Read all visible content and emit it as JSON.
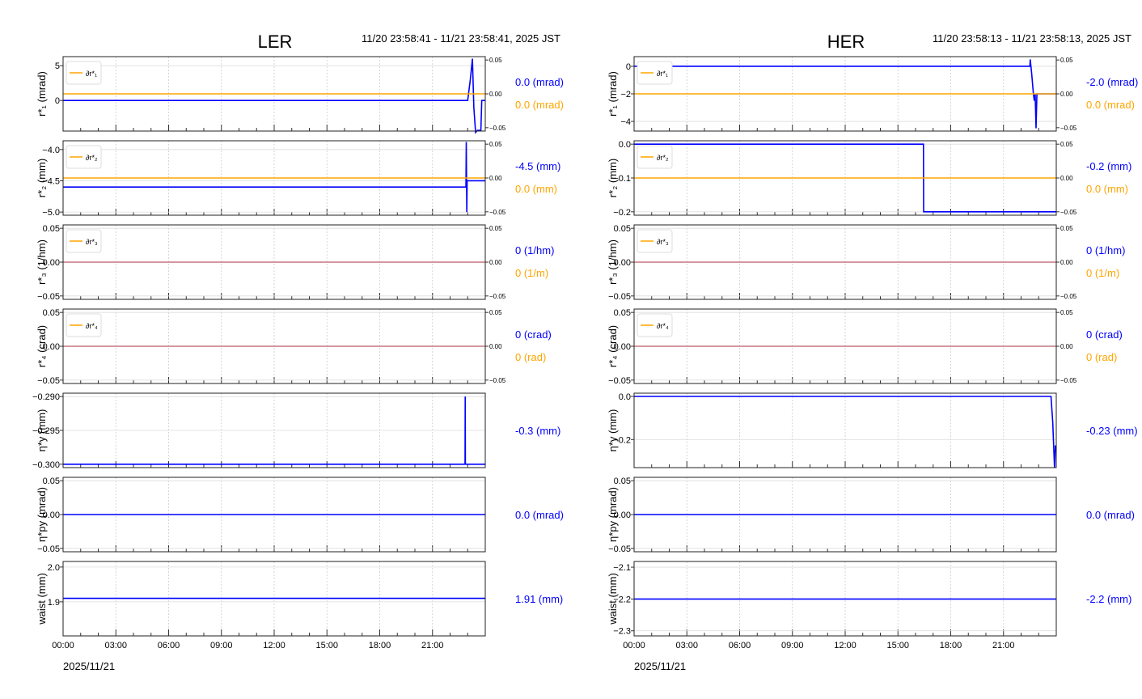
{
  "chart_data": [
    {
      "type": "line",
      "title": "LER",
      "time_range": "11/20 23:58:41 - 11/21 23:58:41, 2025 JST",
      "date_label": "2025/11/21",
      "xlim": [
        0,
        24
      ],
      "x_ticks": [
        "00:00",
        "03:00",
        "06:00",
        "09:00",
        "12:00",
        "15:00",
        "18:00",
        "21:00"
      ],
      "panels": [
        {
          "ylabel": "r*₁ (mrad)",
          "ylim": [
            -4.4,
            6.3
          ],
          "yticks": [
            "5",
            "0"
          ],
          "ytick_values": [
            5,
            0
          ],
          "y2lim": [
            -0.055,
            0.055
          ],
          "y2ticks": [
            "0.05",
            "0.00",
            "−0.05"
          ],
          "y2tick_values": [
            0.05,
            0,
            -0.05
          ],
          "legend": "∂r*₁",
          "series": [
            {
              "name": "r1",
              "color": "#0000ff",
              "points": [
                [
                  0,
                  0
                ],
                [
                  23.0,
                  0
                ],
                [
                  23.15,
                  3
                ],
                [
                  23.27,
                  6
                ],
                [
                  23.35,
                  -1
                ],
                [
                  23.45,
                  -4.6
                ],
                [
                  23.55,
                  -4.3
                ],
                [
                  23.75,
                  -4.3
                ],
                [
                  23.8,
                  0
                ],
                [
                  24,
                  0
                ]
              ]
            },
            {
              "name": "∂r1",
              "color": "#ffa500",
              "axis": "y2",
              "points": [
                [
                  0,
                  0
                ],
                [
                  24,
                  0
                ]
              ]
            }
          ],
          "value_labels": [
            {
              "text": "0.0 (mrad)",
              "color": "#0000ff"
            },
            {
              "text": "0.0 (mrad)",
              "color": "#ffa500"
            }
          ]
        },
        {
          "ylabel": "r*₂ (mm)",
          "ylim": [
            -5.05,
            -3.86
          ],
          "yticks": [
            "−4.0",
            "−4.5",
            "−5.0"
          ],
          "ytick_values": [
            -4.0,
            -4.5,
            -5.0
          ],
          "y2lim": [
            -0.055,
            0.055
          ],
          "y2ticks": [
            "0.05",
            "0.00",
            "−0.05"
          ],
          "y2tick_values": [
            0.05,
            0,
            -0.05
          ],
          "legend": "∂r*₂",
          "series": [
            {
              "name": "r2",
              "color": "#0000ff",
              "points": [
                [
                  0,
                  -4.6
                ],
                [
                  22.9,
                  -4.6
                ],
                [
                  22.92,
                  -3.88
                ],
                [
                  22.95,
                  -5.0
                ],
                [
                  22.97,
                  -4.5
                ],
                [
                  24,
                  -4.5
                ]
              ]
            },
            {
              "name": "∂r2",
              "color": "#ffa500",
              "axis": "y2",
              "points": [
                [
                  0,
                  0
                ],
                [
                  24,
                  0
                ]
              ]
            }
          ],
          "value_labels": [
            {
              "text": "-4.5 (mm)",
              "color": "#0000ff"
            },
            {
              "text": "0.0 (mm)",
              "color": "#ffa500"
            }
          ]
        },
        {
          "ylabel": "r*₃ (1/hm)",
          "ylim": [
            -0.055,
            0.055
          ],
          "yticks": [
            "0.05",
            "0.00",
            "−0.05"
          ],
          "ytick_values": [
            0.05,
            0,
            -0.05
          ],
          "y2lim": [
            -0.055,
            0.055
          ],
          "y2ticks": [
            "0.05",
            "0.00",
            "−0.05"
          ],
          "y2tick_values": [
            0.05,
            0,
            -0.05
          ],
          "legend": "∂r*₃",
          "series": [
            {
              "name": "r3",
              "color": "#0000ff",
              "points": [
                [
                  0,
                  0
                ],
                [
                  24,
                  0
                ]
              ]
            },
            {
              "name": "∂r3",
              "color": "#f0a080",
              "axis": "y2",
              "points": [
                [
                  0,
                  0
                ],
                [
                  24,
                  0
                ]
              ]
            }
          ],
          "value_labels": [
            {
              "text": "0 (1/hm)",
              "color": "#0000ff"
            },
            {
              "text": "0 (1/m)",
              "color": "#ffa500"
            }
          ]
        },
        {
          "ylabel": "r*₄ (crad)",
          "ylim": [
            -0.055,
            0.055
          ],
          "yticks": [
            "0.05",
            "0.00",
            "−0.05"
          ],
          "ytick_values": [
            0.05,
            0,
            -0.05
          ],
          "y2lim": [
            -0.055,
            0.055
          ],
          "y2ticks": [
            "0.05",
            "0.00",
            "−0.05"
          ],
          "y2tick_values": [
            0.05,
            0,
            -0.05
          ],
          "legend": "∂r*₄",
          "series": [
            {
              "name": "r4",
              "color": "#0000ff",
              "points": [
                [
                  0,
                  0
                ],
                [
                  24,
                  0
                ]
              ]
            },
            {
              "name": "∂r4",
              "color": "#f0a080",
              "axis": "y2",
              "points": [
                [
                  0,
                  0
                ],
                [
                  24,
                  0
                ]
              ]
            }
          ],
          "value_labels": [
            {
              "text": "0 (crad)",
              "color": "#0000ff"
            },
            {
              "text": "0 (rad)",
              "color": "#ffa500"
            }
          ]
        },
        {
          "ylabel": "η*y (mm)",
          "ylim": [
            -0.3005,
            -0.2895
          ],
          "yticks": [
            "−0.290",
            "−0.295",
            "−0.300"
          ],
          "ytick_values": [
            -0.29,
            -0.295,
            -0.3
          ],
          "series": [
            {
              "name": "eta_y",
              "color": "#0000ff",
              "points": [
                [
                  0,
                  -0.3
                ],
                [
                  22.85,
                  -0.3
                ],
                [
                  22.86,
                  -0.29
                ],
                [
                  22.87,
                  -0.3
                ],
                [
                  24,
                  -0.3
                ]
              ]
            }
          ],
          "value_labels": [
            {
              "text": "-0.3 (mm)",
              "color": "#0000ff"
            }
          ]
        },
        {
          "ylabel": "η*py (mrad)",
          "ylim": [
            -0.055,
            0.055
          ],
          "yticks": [
            "0.05",
            "0.00",
            "−0.05"
          ],
          "ytick_values": [
            0.05,
            0,
            -0.05
          ],
          "series": [
            {
              "name": "eta_py",
              "color": "#0000ff",
              "points": [
                [
                  0,
                  0
                ],
                [
                  24,
                  0
                ]
              ]
            }
          ],
          "value_labels": [
            {
              "text": "0.0 (mrad)",
              "color": "#0000ff"
            }
          ]
        },
        {
          "ylabel": "waist (mm)",
          "ylim": [
            1.802,
            2.016
          ],
          "yticks": [
            "2.0",
            "1.9"
          ],
          "ytick_values": [
            2.0,
            1.9
          ],
          "series": [
            {
              "name": "waist",
              "color": "#0000ff",
              "points": [
                [
                  0,
                  1.91
                ],
                [
                  24,
                  1.91
                ]
              ]
            }
          ],
          "value_labels": [
            {
              "text": "1.91 (mm)",
              "color": "#0000ff"
            }
          ]
        }
      ]
    },
    {
      "type": "line",
      "title": "HER",
      "time_range": "11/20 23:58:13 - 11/21 23:58:13, 2025 JST",
      "date_label": "2025/11/21",
      "xlim": [
        0,
        24
      ],
      "x_ticks": [
        "00:00",
        "03:00",
        "06:00",
        "09:00",
        "12:00",
        "15:00",
        "18:00",
        "21:00"
      ],
      "panels": [
        {
          "ylabel": "r*₁ (mrad)",
          "ylim": [
            -4.7,
            0.7
          ],
          "yticks": [
            "0",
            "−2",
            "−4"
          ],
          "ytick_values": [
            0,
            -2,
            -4
          ],
          "y2lim": [
            -0.055,
            0.055
          ],
          "y2ticks": [
            "0.05",
            "0.00",
            "−0.05"
          ],
          "y2tick_values": [
            0.05,
            0,
            -0.05
          ],
          "legend": "∂r*₁",
          "series": [
            {
              "name": "r1",
              "color": "#0000ff",
              "points": [
                [
                  0,
                  0
                ],
                [
                  22.5,
                  0
                ],
                [
                  22.52,
                  0.5
                ],
                [
                  22.6,
                  -0.5
                ],
                [
                  22.7,
                  -2
                ],
                [
                  22.75,
                  -2.5
                ],
                [
                  22.8,
                  -2
                ],
                [
                  22.85,
                  -4.5
                ],
                [
                  22.9,
                  -2
                ],
                [
                  24,
                  -2
                ]
              ]
            },
            {
              "name": "∂r1",
              "color": "#ffa500",
              "axis": "y2",
              "points": [
                [
                  0,
                  0
                ],
                [
                  24,
                  0
                ]
              ]
            }
          ],
          "value_labels": [
            {
              "text": "-2.0 (mrad)",
              "color": "#0000ff"
            },
            {
              "text": "0.0 (mrad)",
              "color": "#ffa500"
            }
          ]
        },
        {
          "ylabel": "r*₂ (mm)",
          "ylim": [
            -0.21,
            0.01
          ],
          "yticks": [
            "0.0",
            "−0.1",
            "−0.2"
          ],
          "ytick_values": [
            0,
            -0.1,
            -0.2
          ],
          "y2lim": [
            -0.055,
            0.055
          ],
          "y2ticks": [
            "0.05",
            "0.00",
            "−0.05"
          ],
          "y2tick_values": [
            0.05,
            0,
            -0.05
          ],
          "legend": "∂r*₂",
          "series": [
            {
              "name": "r2",
              "color": "#0000ff",
              "points": [
                [
                  0,
                  0
                ],
                [
                  16.45,
                  0
                ],
                [
                  16.46,
                  -0.2
                ],
                [
                  24,
                  -0.2
                ]
              ]
            },
            {
              "name": "∂r2",
              "color": "#ffa500",
              "axis": "y2",
              "points": [
                [
                  0,
                  0
                ],
                [
                  24,
                  0
                ]
              ]
            }
          ],
          "value_labels": [
            {
              "text": "-0.2 (mm)",
              "color": "#0000ff"
            },
            {
              "text": "0.0 (mm)",
              "color": "#ffa500"
            }
          ]
        },
        {
          "ylabel": "r*₃ (1/hm)",
          "ylim": [
            -0.055,
            0.055
          ],
          "yticks": [
            "0.05",
            "0.00",
            "−0.05"
          ],
          "ytick_values": [
            0.05,
            0,
            -0.05
          ],
          "y2lim": [
            -0.055,
            0.055
          ],
          "y2ticks": [
            "0.05",
            "0.00",
            "−0.05"
          ],
          "y2tick_values": [
            0.05,
            0,
            -0.05
          ],
          "legend": "∂r*₃",
          "series": [
            {
              "name": "r3",
              "color": "#0000ff",
              "points": [
                [
                  0,
                  0
                ],
                [
                  24,
                  0
                ]
              ]
            },
            {
              "name": "∂r3",
              "color": "#f0a080",
              "axis": "y2",
              "points": [
                [
                  0,
                  0
                ],
                [
                  24,
                  0
                ]
              ]
            }
          ],
          "value_labels": [
            {
              "text": "0 (1/hm)",
              "color": "#0000ff"
            },
            {
              "text": "0 (1/m)",
              "color": "#ffa500"
            }
          ]
        },
        {
          "ylabel": "r*₄ (crad)",
          "ylim": [
            -0.055,
            0.055
          ],
          "yticks": [
            "0.05",
            "0.00",
            "−0.05"
          ],
          "ytick_values": [
            0.05,
            0,
            -0.05
          ],
          "y2lim": [
            -0.055,
            0.055
          ],
          "y2ticks": [
            "0.05",
            "0.00",
            "−0.05"
          ],
          "y2tick_values": [
            0.05,
            0,
            -0.05
          ],
          "legend": "∂r*₄",
          "series": [
            {
              "name": "r4",
              "color": "#0000ff",
              "points": [
                [
                  0,
                  0
                ],
                [
                  24,
                  0
                ]
              ]
            },
            {
              "name": "∂r4",
              "color": "#f0a080",
              "axis": "y2",
              "points": [
                [
                  0,
                  0
                ],
                [
                  24,
                  0
                ]
              ]
            }
          ],
          "value_labels": [
            {
              "text": "0 (crad)",
              "color": "#0000ff"
            },
            {
              "text": "0 (rad)",
              "color": "#ffa500"
            }
          ]
        },
        {
          "ylabel": "η*y (mm)",
          "ylim": [
            -0.33,
            0.015
          ],
          "yticks": [
            "0.0",
            "−0.2"
          ],
          "ytick_values": [
            0,
            -0.2
          ],
          "series": [
            {
              "name": "eta_y",
              "color": "#0000ff",
              "points": [
                [
                  0,
                  0
                ],
                [
                  23.7,
                  0
                ],
                [
                  23.8,
                  -0.12
                ],
                [
                  23.9,
                  -0.33
                ],
                [
                  23.95,
                  -0.23
                ],
                [
                  24,
                  -0.23
                ]
              ]
            }
          ],
          "value_labels": [
            {
              "text": "-0.23 (mm)",
              "color": "#0000ff"
            }
          ]
        },
        {
          "ylabel": "η*py (mrad)",
          "ylim": [
            -0.055,
            0.055
          ],
          "yticks": [
            "0.05",
            "0.00",
            "−0.05"
          ],
          "ytick_values": [
            0.05,
            0,
            -0.05
          ],
          "series": [
            {
              "name": "eta_py",
              "color": "#0000ff",
              "points": [
                [
                  0,
                  0
                ],
                [
                  24,
                  0
                ]
              ]
            }
          ],
          "value_labels": [
            {
              "text": "0.0 (mrad)",
              "color": "#0000ff"
            }
          ]
        },
        {
          "ylabel": "waist (mm)",
          "ylim": [
            -2.316,
            -2.082
          ],
          "yticks": [
            "−2.1",
            "−2.2",
            "−2.3"
          ],
          "ytick_values": [
            -2.1,
            -2.2,
            -2.3
          ],
          "series": [
            {
              "name": "waist",
              "color": "#0000ff",
              "points": [
                [
                  0,
                  -2.2
                ],
                [
                  24,
                  -2.2
                ]
              ]
            }
          ],
          "value_labels": [
            {
              "text": "-2.2 (mm)",
              "color": "#0000ff"
            }
          ]
        }
      ]
    }
  ]
}
